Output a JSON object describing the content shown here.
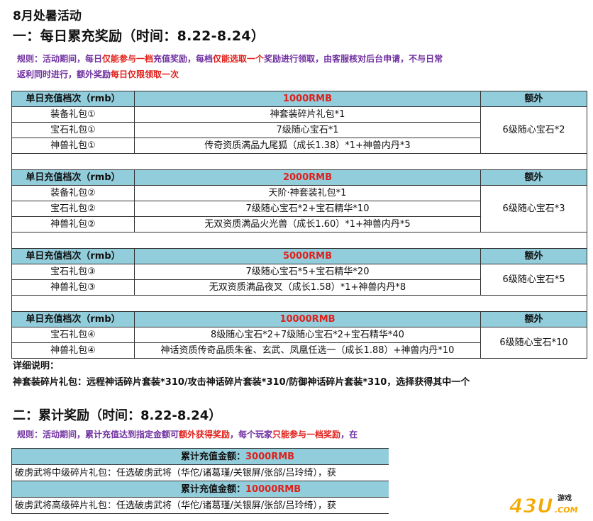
{
  "title": "8月处暑活动",
  "section1": {
    "heading": "一：每日累充奖励（时间：8.22-8.24）",
    "rules_line1": [
      {
        "text": "规则：活动期间，每日",
        "hl": false
      },
      {
        "text": "仅能参与一档",
        "hl": true
      },
      {
        "text": "充值奖励，每档",
        "hl": false
      },
      {
        "text": "仅能选取一个",
        "hl": true
      },
      {
        "text": "奖励进行领取，由客服核对后台申请，不与日常",
        "hl": false
      }
    ],
    "rules_line2": [
      {
        "text": "返利同时进行，额外奖励",
        "hl": false
      },
      {
        "text": "每日仅限领取一次",
        "hl": true
      }
    ],
    "tables": [
      {
        "header": {
          "tier": "单日充值档次（rmb）",
          "amount": "1000RMB",
          "extra": "额外"
        },
        "rows": [
          {
            "name": "装备礼包①",
            "content": "神套装碎片礼包*1"
          },
          {
            "name": "宝石礼包①",
            "content": "7级随心宝石*1"
          },
          {
            "name": "神兽礼包①",
            "content": "传奇资质满品九尾狐（成长1.38）*1+神兽内丹*3"
          }
        ],
        "extra": "6级随心宝石*2"
      },
      {
        "header": {
          "tier": "单日充值档次（rmb）",
          "amount": "2000RMB",
          "extra": "额外"
        },
        "rows": [
          {
            "name": "装备礼包②",
            "content": "天阶·神套装礼包*1"
          },
          {
            "name": "宝石礼包②",
            "content": "7级随心宝石*2+宝石精华*10"
          },
          {
            "name": "神兽礼包②",
            "content": "无双资质满品火光兽（成长1.60）*1+神兽内丹*5"
          }
        ],
        "extra": "6级随心宝石*3"
      },
      {
        "header": {
          "tier": "单日充值档次（rmb）",
          "amount": "5000RMB",
          "extra": "额外"
        },
        "rows": [
          {
            "name": "宝石礼包③",
            "content": "7级随心宝石*5+宝石精华*20"
          },
          {
            "name": "神兽礼包③",
            "content": "无双资质满品夜叉（成长1.58）*1+神兽内丹*8"
          }
        ],
        "extra": "6级随心宝石*5"
      },
      {
        "header": {
          "tier": "单日充值档次（rmb）",
          "amount": "10000RMB",
          "extra": "额外"
        },
        "rows": [
          {
            "name": "宝石礼包④",
            "content": "8级随心宝石*2+7级随心宝石*2+宝石精华*40"
          },
          {
            "name": "神兽礼包④",
            "content": "神话资质传奇品质朱雀、玄武、凤凰任选一（成长1.88）+神兽内丹*10"
          }
        ],
        "extra": "6级随心宝石*10"
      }
    ],
    "detail_label": "详细说明：",
    "detail_text": "神套装碎片礼包：远程神话碎片套装*310/攻击神话碎片套装*310/防御神话碎片套装*310，选择获得其中一个"
  },
  "section2": {
    "heading": "二：累计奖励（时间：8.22-8.24）",
    "rules": [
      {
        "text": "规则：活动期间，累计充值达到指定金额可",
        "hl": false
      },
      {
        "text": "额外获得奖励",
        "hl": true
      },
      {
        "text": "，每个玩家",
        "hl": false
      },
      {
        "text": "只能参与一档奖励",
        "hl": true
      },
      {
        "text": "，在",
        "hl": false
      }
    ],
    "tiers": [
      {
        "label": "累计充值金额：",
        "amount": "3000RMB",
        "content": "破虏武将中级碎片礼包：任选破虏武将（华佗/诸葛瑾/关银屏/张郃/吕玲绮），获"
      },
      {
        "label": "累计充值金额：",
        "amount": "10000RMB",
        "content": "破虏武将高级碎片礼包：任选破虏武将（华佗/诸葛瑾/关银屏/张郃/吕玲绮），获"
      }
    ]
  },
  "watermark": {
    "logo_text": "43U",
    "suffix": "游戏",
    "domain": ".COM"
  }
}
